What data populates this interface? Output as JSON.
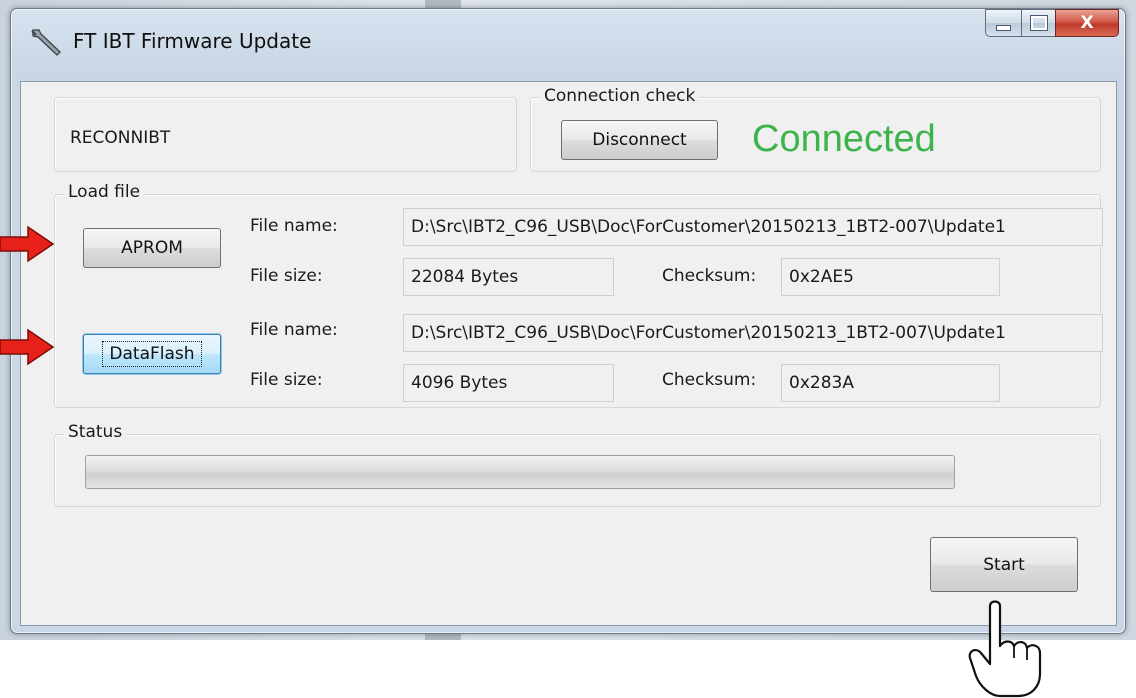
{
  "window": {
    "title": "FT IBT Firmware Update",
    "close_glyph": "X"
  },
  "device": {
    "name": "RECONNIBT"
  },
  "connection": {
    "group_label": "Connection check",
    "disconnect_label": "Disconnect",
    "status_text": "Connected",
    "status_color": "#3cb44b"
  },
  "load_file": {
    "group_label": "Load file",
    "aprom": {
      "button_label": "APROM",
      "file_name_label": "File name:",
      "file_name_value": "D:\\Src\\IBT2_C96_USB\\Doc\\ForCustomer\\20150213_1BT2-007\\Update1",
      "file_size_label": "File size:",
      "file_size_value": "22084 Bytes",
      "checksum_label": "Checksum:",
      "checksum_value": "0x2AE5"
    },
    "dataflash": {
      "button_label": "DataFlash",
      "file_name_label": "File name:",
      "file_name_value": "D:\\Src\\IBT2_C96_USB\\Doc\\ForCustomer\\20150213_1BT2-007\\Update1",
      "file_size_label": "File size:",
      "file_size_value": "4096 Bytes",
      "checksum_label": "Checksum:",
      "checksum_value": "0x283A"
    }
  },
  "status": {
    "group_label": "Status",
    "progress": 0
  },
  "actions": {
    "start_label": "Start"
  },
  "icons": {
    "app": "wrench-icon",
    "arrows": "red-arrow-icon",
    "pointer": "pointing-hand-icon"
  },
  "colors": {
    "arrow": "#e8201a",
    "connected": "#3cb44b"
  }
}
